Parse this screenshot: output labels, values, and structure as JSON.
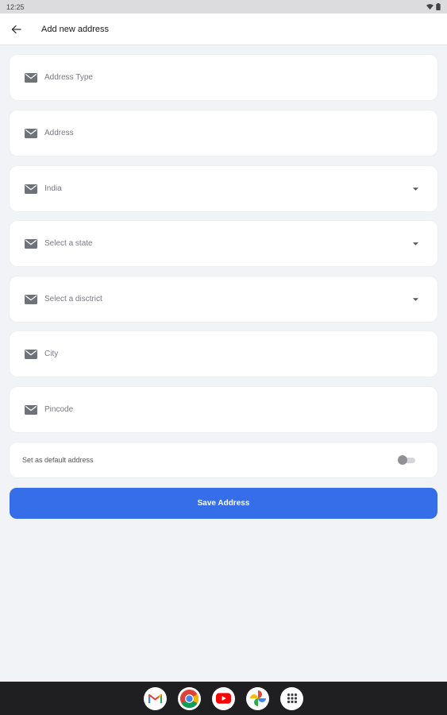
{
  "status_bar": {
    "time": "12:25"
  },
  "app_bar": {
    "title": "Add new address"
  },
  "form": {
    "fields": [
      {
        "placeholder": "Address Type",
        "dropdown": false
      },
      {
        "placeholder": "Address",
        "dropdown": false
      },
      {
        "placeholder": "India",
        "dropdown": true
      },
      {
        "placeholder": "Select a state",
        "dropdown": true
      },
      {
        "placeholder": "Select a disctrict",
        "dropdown": true
      },
      {
        "placeholder": "City",
        "dropdown": false
      },
      {
        "placeholder": "Pincode",
        "dropdown": false
      }
    ],
    "default_toggle": {
      "label": "Set as default address",
      "on": false
    },
    "save_label": "Save Address"
  },
  "colors": {
    "accent": "#356ee8",
    "background": "#f1f3f6",
    "icon": "#6f7278"
  },
  "nav_apps": [
    "gmail-icon",
    "chrome-icon",
    "youtube-icon",
    "photos-icon",
    "app-drawer-icon"
  ]
}
